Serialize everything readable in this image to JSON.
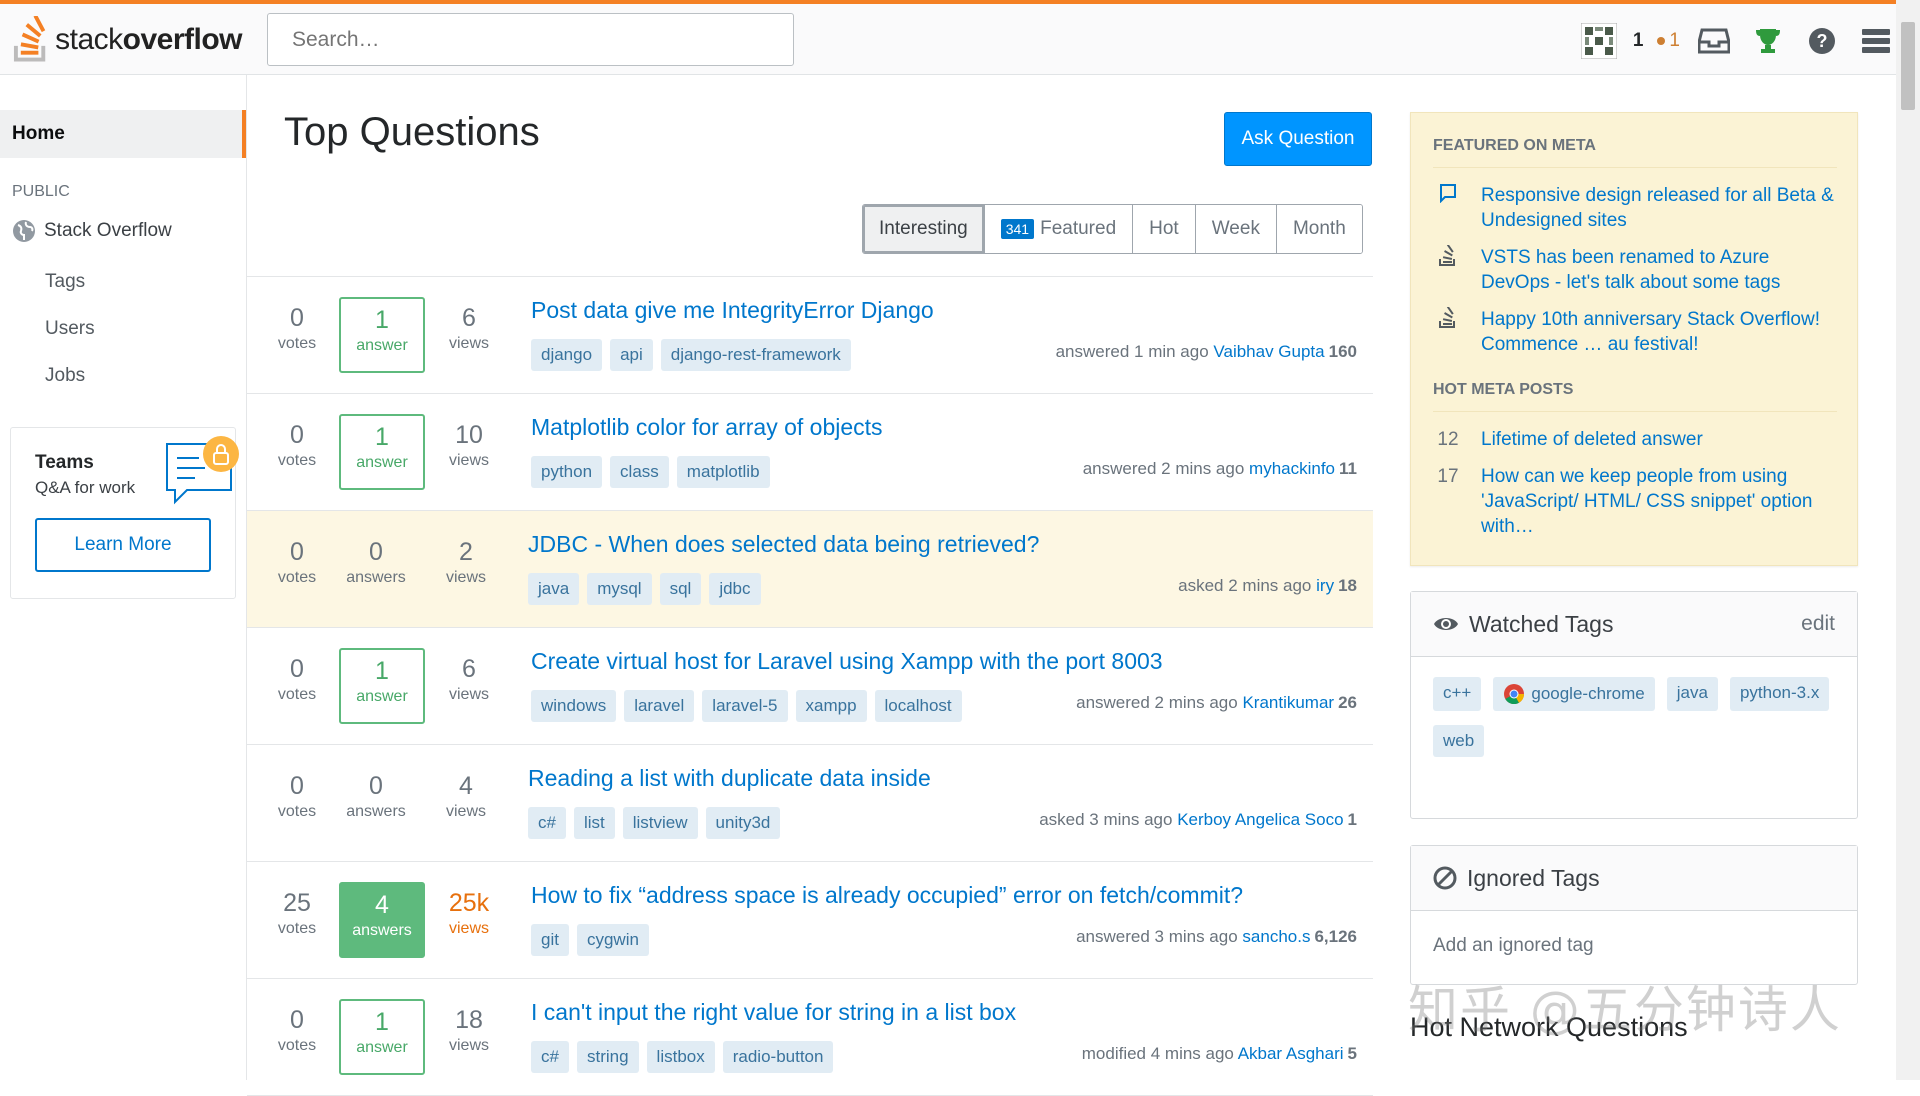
{
  "header": {
    "logo_text_light": "stack",
    "logo_text_bold": "overflow",
    "search_placeholder": "Search…",
    "reputation": "1",
    "bronze_badges": "1"
  },
  "leftnav": {
    "home": "Home",
    "public": "PUBLIC",
    "stack_overflow": "Stack Overflow",
    "tags": "Tags",
    "users": "Users",
    "jobs": "Jobs",
    "teams_title": "Teams",
    "teams_sub": "Q&A for work",
    "learn_more": "Learn More"
  },
  "main": {
    "title": "Top Questions",
    "ask_button": "Ask Question",
    "filters": {
      "interesting": "Interesting",
      "featured_count": "341",
      "featured": "Featured",
      "hot": "Hot",
      "week": "Week",
      "month": "Month"
    },
    "questions": [
      {
        "votes": "0",
        "votes_label": "votes",
        "answers": "1",
        "answers_label": "answer",
        "views": "6",
        "views_label": "views",
        "title": "Post data give me IntegrityError Django",
        "tags": [
          "django",
          "api",
          "django-rest-framework"
        ],
        "action": "answered 1 min ago",
        "user": "Vaibhav Gupta",
        "rep": "160"
      },
      {
        "votes": "0",
        "votes_label": "votes",
        "answers": "1",
        "answers_label": "answer",
        "views": "10",
        "views_label": "views",
        "title": "Matplotlib color for array of objects",
        "tags": [
          "python",
          "class",
          "matplotlib"
        ],
        "action": "answered 2 mins ago",
        "user": "myhackinfo",
        "rep": "11"
      },
      {
        "votes": "0",
        "votes_label": "votes",
        "answers": "0",
        "answers_label": "answers",
        "views": "2",
        "views_label": "views",
        "title": "JDBC - When does selected data being retrieved?",
        "tags": [
          "java",
          "mysql",
          "sql",
          "jdbc"
        ],
        "action": "asked 2 mins ago",
        "user": "iry",
        "rep": "18"
      },
      {
        "votes": "0",
        "votes_label": "votes",
        "answers": "1",
        "answers_label": "answer",
        "views": "6",
        "views_label": "views",
        "title": "Create virtual host for Laravel using Xampp with the port 8003",
        "tags": [
          "windows",
          "laravel",
          "laravel-5",
          "xampp",
          "localhost"
        ],
        "action": "answered 2 mins ago",
        "user": "Krantikumar",
        "rep": "26"
      },
      {
        "votes": "0",
        "votes_label": "votes",
        "answers": "0",
        "answers_label": "answers",
        "views": "4",
        "views_label": "views",
        "title": "Reading a list with duplicate data inside",
        "tags": [
          "c#",
          "list",
          "listview",
          "unity3d"
        ],
        "action": "asked 3 mins ago",
        "user": "Kerboy Angelica Soco",
        "rep": "1"
      },
      {
        "votes": "25",
        "votes_label": "votes",
        "answers": "4",
        "answers_label": "answers",
        "views": "25k",
        "views_label": "views",
        "title": "How to fix “address space is already occupied” error on fetch/commit?",
        "tags": [
          "git",
          "cygwin"
        ],
        "action": "answered 3 mins ago",
        "user": "sancho.s",
        "rep": "6,126"
      },
      {
        "votes": "0",
        "votes_label": "votes",
        "answers": "1",
        "answers_label": "answer",
        "views": "18",
        "views_label": "views",
        "title": "I can't input the right value for string in a list box",
        "tags": [
          "c#",
          "string",
          "listbox",
          "radio-button"
        ],
        "action": "modified 4 mins ago",
        "user": "Akbar Asghari",
        "rep": "5"
      }
    ]
  },
  "sidebar": {
    "featured_heading": "FEATURED ON META",
    "featured": [
      "Responsive design released for all Beta & Undesigned sites",
      "VSTS has been renamed to Azure DevOps - let's talk about some tags",
      "Happy 10th anniversary Stack Overflow! Commence … au festival!"
    ],
    "hot_meta_heading": "HOT META POSTS",
    "hot_meta": [
      {
        "count": "12",
        "title": "Lifetime of deleted answer"
      },
      {
        "count": "17",
        "title": "How can we keep people from using 'JavaScript/ HTML/ CSS snippet' option with…"
      }
    ],
    "watched_title": "Watched Tags",
    "watched_edit": "edit",
    "watched_tags": [
      "c++",
      "google-chrome",
      "java",
      "python-3.x",
      "web"
    ],
    "ignored_title": "Ignored Tags",
    "ignored_add": "Add an ignored tag",
    "hot_network": "Hot Network Questions"
  },
  "watermark": "知乎 @五分钟诗人"
}
